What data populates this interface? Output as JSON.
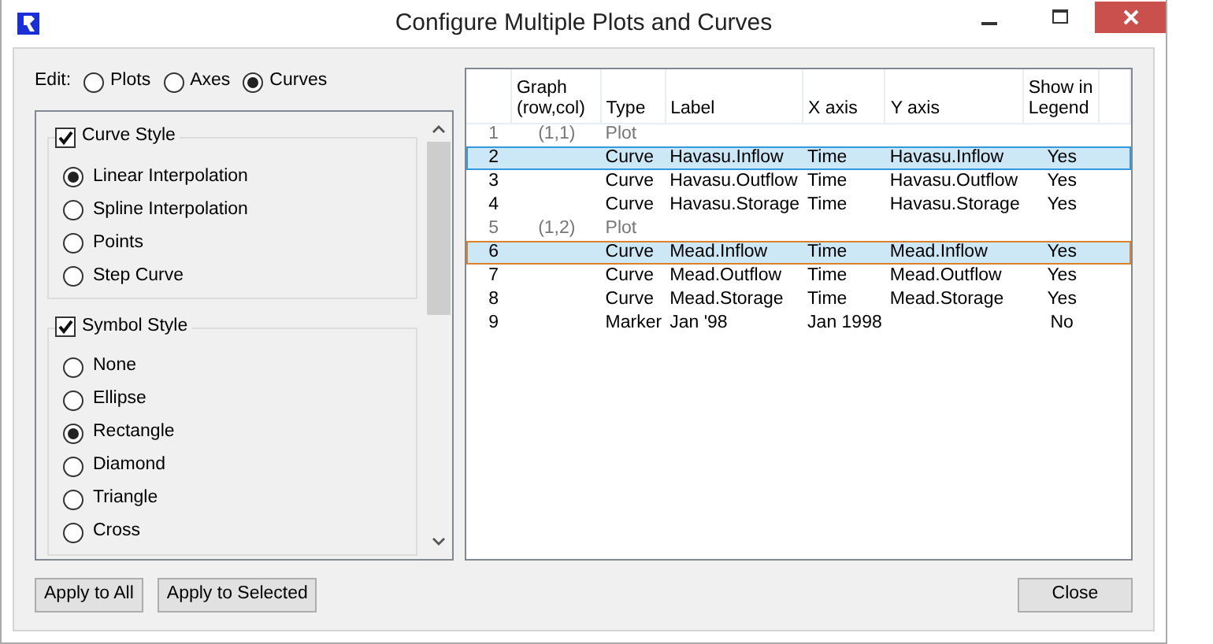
{
  "window": {
    "title": "Configure Multiple Plots and Curves"
  },
  "edit": {
    "label": "Edit:",
    "options": [
      {
        "label": "Plots",
        "selected": false
      },
      {
        "label": "Axes",
        "selected": false
      },
      {
        "label": "Curves",
        "selected": true
      }
    ]
  },
  "groups": [
    {
      "title": "Curve Style",
      "checked": true,
      "options": [
        {
          "label": "Linear Interpolation",
          "selected": true
        },
        {
          "label": "Spline Interpolation",
          "selected": false
        },
        {
          "label": "Points",
          "selected": false
        },
        {
          "label": "Step Curve",
          "selected": false
        }
      ]
    },
    {
      "title": "Symbol Style",
      "checked": true,
      "options": [
        {
          "label": "None",
          "selected": false
        },
        {
          "label": "Ellipse",
          "selected": false
        },
        {
          "label": "Rectangle",
          "selected": true
        },
        {
          "label": "Diamond",
          "selected": false
        },
        {
          "label": "Triangle",
          "selected": false
        },
        {
          "label": "Cross",
          "selected": false
        }
      ]
    }
  ],
  "table": {
    "columns": [
      "Graph (row,col)",
      "Type",
      "Label",
      "X axis",
      "Y axis",
      "Show in Legend"
    ],
    "rows": [
      {
        "number": "1",
        "kind": "plot",
        "selected": false,
        "focused": false,
        "cells": [
          "(1,1)",
          "Plot",
          "",
          "",
          "",
          ""
        ]
      },
      {
        "number": "2",
        "kind": "curve",
        "selected": true,
        "focused": false,
        "cells": [
          "",
          "Curve",
          "Havasu.Inflow",
          "Time",
          "Havasu.Inflow",
          "Yes"
        ]
      },
      {
        "number": "3",
        "kind": "curve",
        "selected": false,
        "focused": false,
        "cells": [
          "",
          "Curve",
          "Havasu.Outflow",
          "Time",
          "Havasu.Outflow",
          "Yes"
        ]
      },
      {
        "number": "4",
        "kind": "curve",
        "selected": false,
        "focused": false,
        "cells": [
          "",
          "Curve",
          "Havasu.Storage",
          "Time",
          "Havasu.Storage",
          "Yes"
        ]
      },
      {
        "number": "5",
        "kind": "plot",
        "selected": false,
        "focused": false,
        "cells": [
          "(1,2)",
          "Plot",
          "",
          "",
          "",
          ""
        ]
      },
      {
        "number": "6",
        "kind": "curve",
        "selected": true,
        "focused": true,
        "cells": [
          "",
          "Curve",
          "Mead.Inflow",
          "Time",
          "Mead.Inflow",
          "Yes"
        ]
      },
      {
        "number": "7",
        "kind": "curve",
        "selected": false,
        "focused": false,
        "cells": [
          "",
          "Curve",
          "Mead.Outflow",
          "Time",
          "Mead.Outflow",
          "Yes"
        ]
      },
      {
        "number": "8",
        "kind": "curve",
        "selected": false,
        "focused": false,
        "cells": [
          "",
          "Curve",
          "Mead.Storage",
          "Time",
          "Mead.Storage",
          "Yes"
        ]
      },
      {
        "number": "9",
        "kind": "marker",
        "selected": false,
        "focused": false,
        "cells": [
          "",
          "Marker",
          "Jan '98",
          "Jan 1998",
          "",
          "No"
        ]
      }
    ]
  },
  "buttons": [
    {
      "label": "Apply to All"
    },
    {
      "label": "Apply to Selected"
    }
  ],
  "close_button": {
    "label": "Close"
  }
}
